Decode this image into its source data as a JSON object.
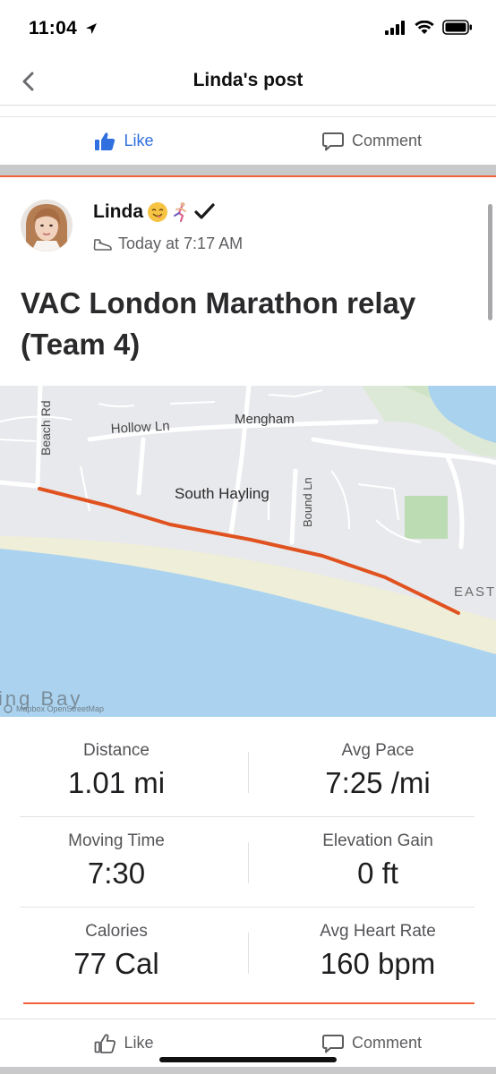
{
  "status_bar": {
    "time": "11:04"
  },
  "nav": {
    "title": "Linda's post"
  },
  "actions": {
    "like_label": "Like",
    "comment_label": "Comment"
  },
  "post": {
    "author": "Linda",
    "timestamp": "Today at 7:17 AM",
    "title": "VAC London Marathon relay (Team 4)"
  },
  "map": {
    "labels": {
      "beach_rd": "Beach Rd",
      "hollow_ln": "Hollow Ln",
      "mengham": "Mengham",
      "south_hayling": "South Hayling",
      "bound_ln": "Bound Ln",
      "east": "EAST",
      "bay": "ing Bay",
      "attribution": "Mapbox OpenStreetMap"
    }
  },
  "stats": [
    {
      "label": "Distance",
      "value": "1.01 mi"
    },
    {
      "label": "Avg Pace",
      "value": "7:25 /mi"
    },
    {
      "label": "Moving Time",
      "value": "7:30"
    },
    {
      "label": "Elevation Gain",
      "value": "0 ft"
    },
    {
      "label": "Calories",
      "value": "77 Cal"
    },
    {
      "label": "Avg Heart Rate",
      "value": "160 bpm"
    }
  ],
  "colors": {
    "accent_orange": "#f0623a",
    "like_blue": "#2f6fdf",
    "route": "#e0521f"
  }
}
